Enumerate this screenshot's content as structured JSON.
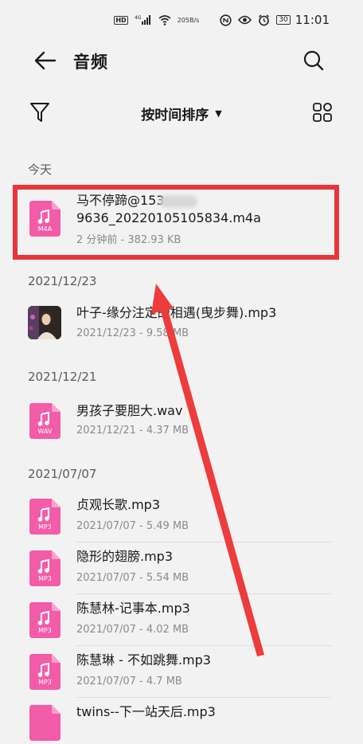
{
  "status_bar": {
    "hd": "HD",
    "signal": "4G",
    "net_speed_value": "205",
    "net_speed_unit": "B/s",
    "battery": "30",
    "time": "11:01"
  },
  "header": {
    "title": "音频"
  },
  "toolbar": {
    "sort_label": "按时间排序"
  },
  "sections": [
    {
      "header": "今天",
      "items": [
        {
          "name_line1": "马不停蹄@153",
          "name_line2": "9636_20220105105834.m4a",
          "meta": "2 分钟前 - 382.93 KB",
          "type_label": "M4A"
        }
      ]
    },
    {
      "header": "2021/12/23",
      "items": [
        {
          "name": "叶子-缘分注定的相遇(曳步舞).mp3",
          "meta": "2021/12/23 - 9.58 MB"
        }
      ]
    },
    {
      "header": "2021/12/21",
      "items": [
        {
          "name": "男孩子要胆大.wav",
          "meta": "2021/12/21 - 4.37 MB",
          "type_label": "WAV"
        }
      ]
    },
    {
      "header": "2021/07/07",
      "items": [
        {
          "name": "贞观长歌.mp3",
          "meta": "2021/07/07 - 5.49 MB",
          "type_label": "MP3"
        },
        {
          "name": "隐形的翅膀.mp3",
          "meta": "2021/07/07 - 5.54 MB",
          "type_label": "MP3"
        },
        {
          "name": "陈慧林-记事本.mp3",
          "meta": "2021/07/07 - 4.02 MB",
          "type_label": "MP3"
        },
        {
          "name": "陈慧琳 - 不如跳舞.mp3",
          "meta": "2021/07/07 - 4.7 MB",
          "type_label": "MP3"
        },
        {
          "name": "twins--下一站天后.mp3"
        }
      ]
    }
  ],
  "colors": {
    "background": "#f2f2f2",
    "file_icon": "#f25ca8",
    "highlight": "#e8363a",
    "arrow": "#ee3b3b"
  }
}
